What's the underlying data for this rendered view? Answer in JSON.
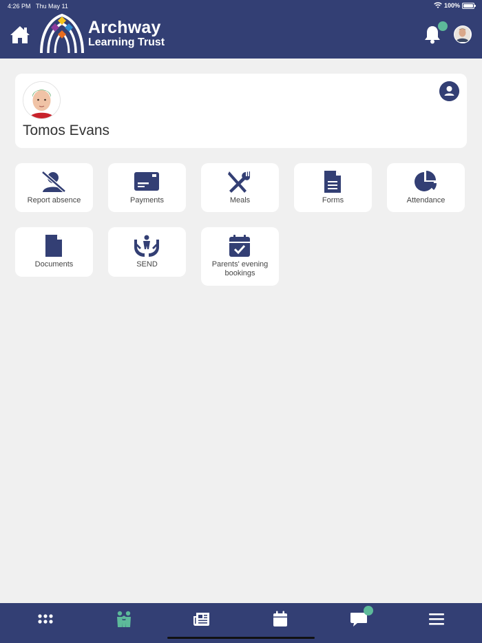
{
  "status_bar": {
    "time": "4:26 PM",
    "date": "Thu May 11",
    "battery": "100%"
  },
  "header": {
    "logo_line1": "Archway",
    "logo_line2": "Learning Trust"
  },
  "profile": {
    "name": "Tomos Evans"
  },
  "tiles": [
    {
      "label": "Report absence",
      "icon": "user-slash-icon"
    },
    {
      "label": "Payments",
      "icon": "credit-card-icon"
    },
    {
      "label": "Meals",
      "icon": "utensils-icon"
    },
    {
      "label": "Forms",
      "icon": "document-lines-icon"
    },
    {
      "label": "Attendance",
      "icon": "pie-chart-icon"
    },
    {
      "label": "Documents",
      "icon": "file-icon"
    },
    {
      "label": "SEND",
      "icon": "hands-child-icon"
    },
    {
      "label": "Parents' evening bookings",
      "icon": "calendar-check-icon"
    }
  ],
  "bottom_nav": [
    {
      "name": "apps",
      "icon": "grid-icon",
      "active": false
    },
    {
      "name": "family",
      "icon": "family-icon",
      "active": true
    },
    {
      "name": "news",
      "icon": "newspaper-icon",
      "active": false
    },
    {
      "name": "calendar",
      "icon": "calendar-icon",
      "active": false
    },
    {
      "name": "messages",
      "icon": "chat-icon",
      "active": false
    },
    {
      "name": "menu",
      "icon": "menu-icon",
      "active": false
    }
  ],
  "colors": {
    "brand": "#333f74",
    "accent": "#5dba9a",
    "background": "#f0f0f0"
  }
}
